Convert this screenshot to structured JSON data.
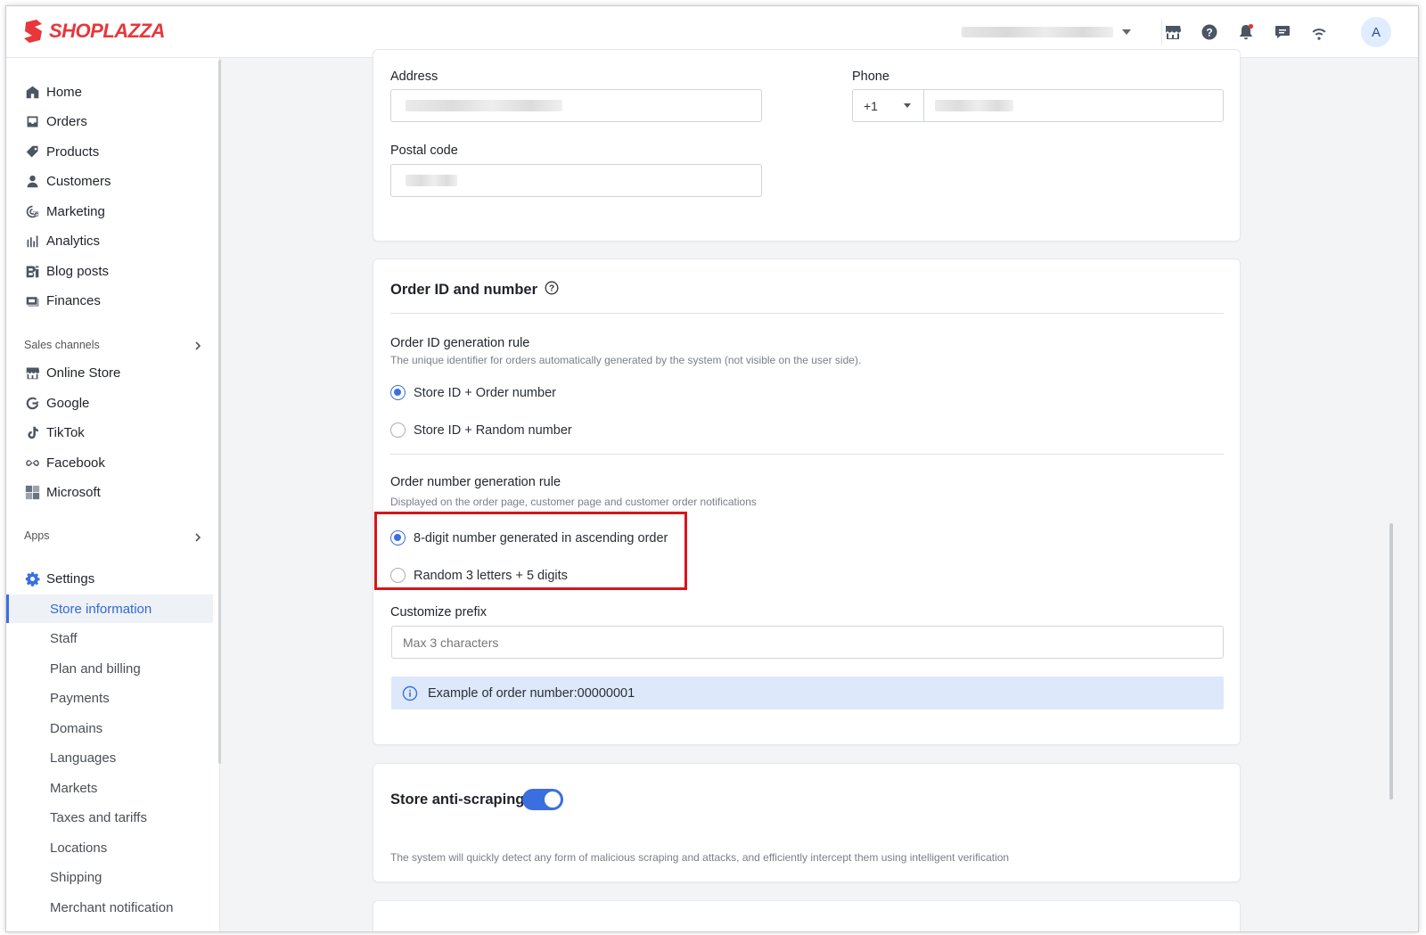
{
  "brand": {
    "name": "SHOPLAZZA",
    "color": "#e8363a"
  },
  "header": {
    "icons": [
      "store-icon",
      "help-icon",
      "bell-icon",
      "message-icon",
      "wifi-icon"
    ],
    "avatar_letter": "A"
  },
  "sidebar": {
    "main_items": [
      {
        "label": "Home",
        "icon": "home-icon"
      },
      {
        "label": "Orders",
        "icon": "orders-icon"
      },
      {
        "label": "Products",
        "icon": "tag-icon"
      },
      {
        "label": "Customers",
        "icon": "person-icon"
      },
      {
        "label": "Marketing",
        "icon": "marketing-icon"
      },
      {
        "label": "Analytics",
        "icon": "bar-chart-icon"
      },
      {
        "label": "Blog posts",
        "icon": "blog-icon"
      },
      {
        "label": "Finances",
        "icon": "finance-icon"
      }
    ],
    "sales_channels_label": "Sales channels",
    "sales_channels": [
      {
        "label": "Online Store",
        "icon": "store-icon"
      },
      {
        "label": "Google",
        "icon": "google-icon"
      },
      {
        "label": "TikTok",
        "icon": "tiktok-icon"
      },
      {
        "label": "Facebook",
        "icon": "meta-icon"
      },
      {
        "label": "Microsoft",
        "icon": "microsoft-icon"
      }
    ],
    "apps_label": "Apps",
    "settings_label": "Settings",
    "settings_items": [
      "Store information",
      "Staff",
      "Plan and billing",
      "Payments",
      "Domains",
      "Languages",
      "Markets",
      "Taxes and tariffs",
      "Locations",
      "Shipping",
      "Merchant notification"
    ],
    "active_item": "Store information"
  },
  "address_card": {
    "address_label": "Address",
    "phone_label": "Phone",
    "phone_code": "+1",
    "postal_label": "Postal code"
  },
  "order_card": {
    "title": "Order ID and number",
    "id_rule_title": "Order ID generation rule",
    "id_rule_desc": "The unique identifier for orders automatically generated by the system (not visible on the user side).",
    "id_options": [
      {
        "label": "Store ID + Order number",
        "checked": true
      },
      {
        "label": "Store ID + Random number",
        "checked": false
      }
    ],
    "number_rule_title": "Order number generation rule",
    "number_rule_desc": "Displayed on the order page, customer page and customer order notifications",
    "number_options": [
      {
        "label": "8-digit number generated in ascending order",
        "checked": true
      },
      {
        "label": "Random 3 letters + 5 digits",
        "checked": false
      }
    ],
    "prefix_label": "Customize prefix",
    "prefix_placeholder": "Max 3 characters",
    "example_text": "Example of order number:00000001"
  },
  "anti_scraping": {
    "title": "Store anti-scraping",
    "enabled": true,
    "desc": "The system will quickly detect any form of malicious scraping and attacks, and efficiently intercept them using intelligent verification"
  },
  "colors": {
    "accent": "#3b6fe0",
    "highlight": "#d9141a",
    "info_bg": "#dde9fb"
  }
}
